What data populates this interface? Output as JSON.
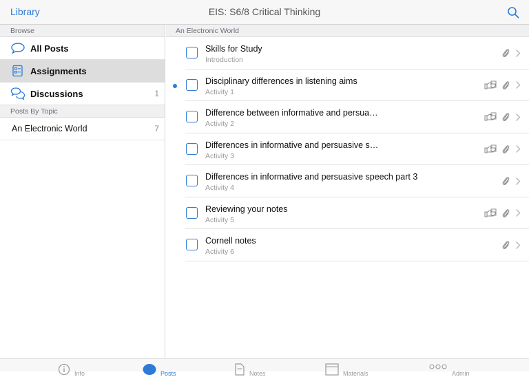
{
  "nav": {
    "back_label": "Library",
    "title": "EIS: S6/8 Critical Thinking",
    "search_icon": "search-icon"
  },
  "sidebar": {
    "browse_header": "Browse",
    "items": [
      {
        "label": "All Posts",
        "icon": "speech-bubble-icon",
        "count": ""
      },
      {
        "label": "Assignments",
        "icon": "checklist-icon",
        "count": ""
      },
      {
        "label": "Discussions",
        "icon": "discussion-bubbles-icon",
        "count": "1"
      }
    ],
    "topics_header": "Posts By Topic",
    "topics": [
      {
        "label": "An Electronic World",
        "count": "7"
      }
    ]
  },
  "main": {
    "section_header": "An Electronic World",
    "rows": [
      {
        "title": "Skills for Study",
        "subtitle": "Introduction",
        "unread": false,
        "handin": false
      },
      {
        "title": "Disciplinary differences in listening aims",
        "subtitle": "Activity 1",
        "unread": true,
        "handin": true
      },
      {
        "title": "Difference between informative and persua…",
        "subtitle": "Activity 2",
        "unread": false,
        "handin": true
      },
      {
        "title": "Differences in informative and persuasive s…",
        "subtitle": "Activity 3",
        "unread": false,
        "handin": true
      },
      {
        "title": "Differences in informative and persuasive speech part 3",
        "subtitle": "Activity 4",
        "unread": false,
        "handin": false
      },
      {
        "title": "Reviewing your notes",
        "subtitle": "Activity 5",
        "unread": false,
        "handin": true
      },
      {
        "title": "Cornell notes",
        "subtitle": "Activity 6",
        "unread": false,
        "handin": false
      }
    ]
  },
  "tabbar": {
    "tabs": [
      {
        "label": "Info",
        "icon": "info-icon",
        "active": false
      },
      {
        "label": "Posts",
        "icon": "posts-icon",
        "active": true
      },
      {
        "label": "Notes",
        "icon": "notes-icon",
        "active": false
      },
      {
        "label": "Materials",
        "icon": "materials-icon",
        "active": false
      },
      {
        "label": "Admin",
        "icon": "admin-icon",
        "active": false
      }
    ]
  },
  "colors": {
    "accent": "#2d7bd6",
    "selected": "#dddddd"
  }
}
